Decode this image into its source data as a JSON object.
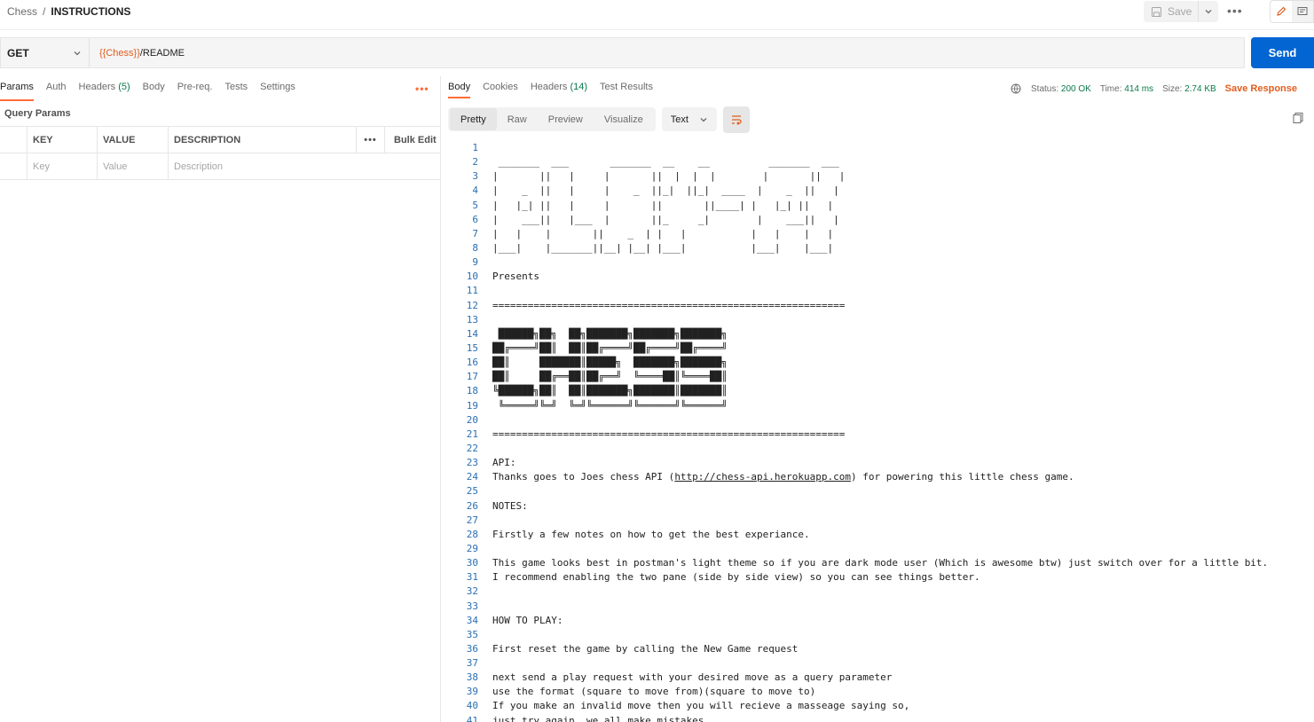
{
  "header": {
    "breadcrumb_parent": "Chess",
    "breadcrumb_sep": "/",
    "breadcrumb_current": "INSTRUCTIONS",
    "save_label": "Save",
    "more_label": "•••"
  },
  "request": {
    "method": "GET",
    "url_variable": "{{Chess}}",
    "url_path": "/README",
    "send_label": "Send",
    "tabs": [
      {
        "label": "Params",
        "count": ""
      },
      {
        "label": "Auth",
        "count": ""
      },
      {
        "label": "Headers",
        "count": "(5)"
      },
      {
        "label": "Body",
        "count": ""
      },
      {
        "label": "Pre-req.",
        "count": ""
      },
      {
        "label": "Tests",
        "count": ""
      },
      {
        "label": "Settings",
        "count": ""
      }
    ],
    "query_params_title": "Query Params",
    "table_headers": {
      "key": "KEY",
      "value": "VALUE",
      "description": "DESCRIPTION",
      "bulk_edit": "Bulk Edit",
      "more": "•••"
    },
    "placeholders": {
      "key": "Key",
      "value": "Value",
      "description": "Description"
    }
  },
  "response": {
    "tabs": [
      {
        "label": "Body",
        "count": ""
      },
      {
        "label": "Cookies",
        "count": ""
      },
      {
        "label": "Headers",
        "count": "(14)"
      },
      {
        "label": "Test Results",
        "count": ""
      }
    ],
    "status_label": "Status:",
    "status_value": "200 OK",
    "time_label": "Time:",
    "time_value": "414 ms",
    "size_label": "Size:",
    "size_value": "2.74 KB",
    "save_response": "Save Response",
    "view_modes": [
      "Pretty",
      "Raw",
      "Preview",
      "Visualize"
    ],
    "format": "Text",
    "lines": [
      "",
      " _______  ___       _______  __    __          _______  ___",
      "|       ||   |     |       ||  |  |  |        |       ||   |",
      "|    _  ||   |     |    _  ||_|  ||_|  ____  |    _  ||   |",
      "|   |_| ||   |     |       ||       ||____| |   |_| ||   |",
      "|    ___||   |___  |       ||_     _|        |    ___||   |",
      "|   |    |       ||    _  | |   |           |   |    |   |",
      "|___|    |_______||__| |__| |___|           |___|    |___|",
      "",
      "Presents",
      "",
      "============================================================",
      "",
      " ██████╗██╗  ██╗███████╗███████╗███████╗",
      "██╔════╝██║  ██║██╔════╝██╔════╝██╔════╝",
      "██║     ███████║█████╗  ███████╗███████╗",
      "██║     ██╔══██║██╔══╝  ╚════██║╚════██║",
      "╚██████╗██║  ██║███████╗███████║███████║",
      " ╚═════╝╚═╝  ╚═╝╚══════╝╚══════╝╚══════╝",
      "",
      "============================================================",
      "",
      "API:",
      "Thanks goes to Joes chess API (http://chess-api.herokuapp.com) for powering this little chess game.",
      "",
      "NOTES:",
      "",
      "Firstly a few notes on how to get the best experiance.",
      "",
      "This game looks best in postman's light theme so if you are dark mode user (Which is awesome btw) just switch over for a little bit.",
      "I recommend enabling the two pane (side by side view) so you can see things better.",
      "",
      "",
      "HOW TO PLAY:",
      "",
      "First reset the game by calling the New Game request",
      "",
      "next send a play request with your desired move as a query parameter",
      "use the format (square to move from)(square to move to)",
      "If you make an invalid move then you will recieve a masseage saying so,",
      "just try again, we all make mistakes."
    ]
  }
}
